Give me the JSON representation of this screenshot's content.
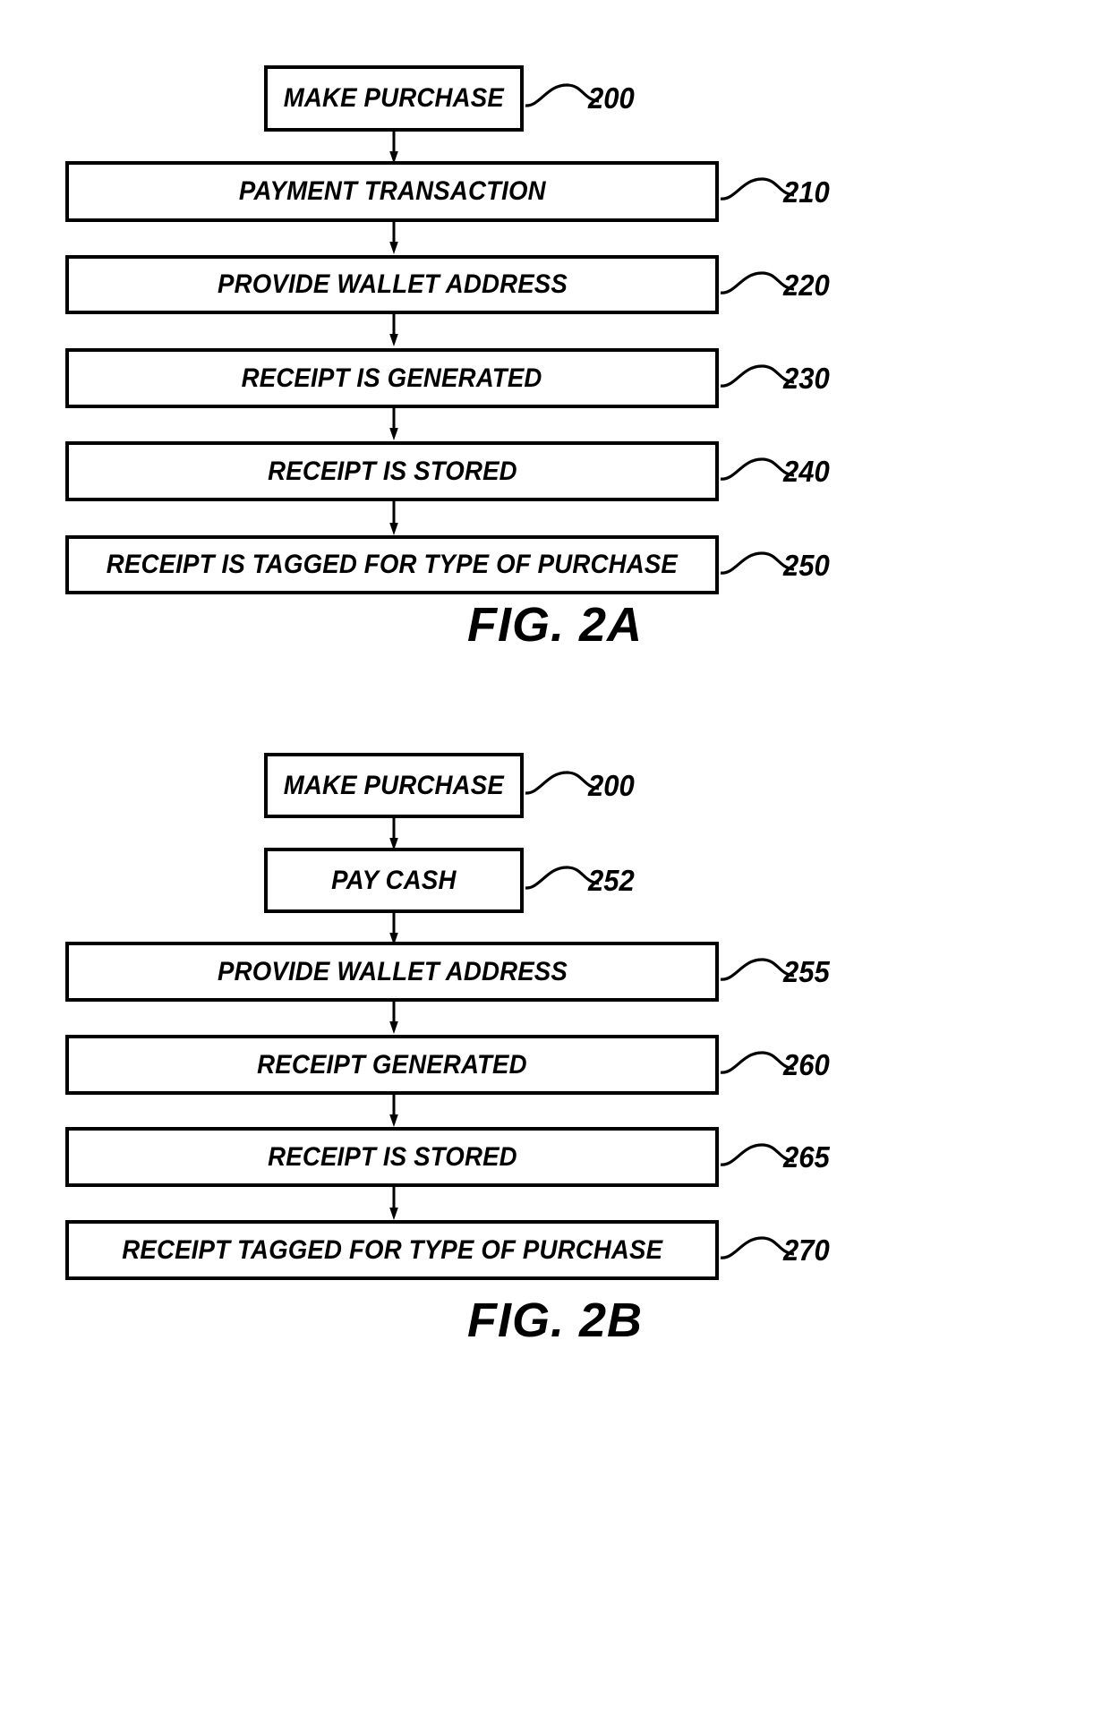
{
  "document": {
    "type": "patent-flowchart-sheet",
    "background_color": "#ffffff",
    "stroke_color": "#000000"
  },
  "figures": [
    {
      "id": "fig-2a",
      "caption": "FIG. 2A",
      "nodes": [
        {
          "id": "200",
          "label": "MAKE PURCHASE",
          "ref": "200",
          "width": "narrow"
        },
        {
          "id": "210",
          "label": "PAYMENT TRANSACTION",
          "ref": "210",
          "width": "wide"
        },
        {
          "id": "220",
          "label": "PROVIDE WALLET ADDRESS",
          "ref": "220",
          "width": "wide"
        },
        {
          "id": "230",
          "label": "RECEIPT IS GENERATED",
          "ref": "230",
          "width": "wide"
        },
        {
          "id": "240",
          "label": "RECEIPT IS STORED",
          "ref": "240",
          "width": "wide"
        },
        {
          "id": "250",
          "label": "RECEIPT IS TAGGED FOR TYPE OF PURCHASE",
          "ref": "250",
          "width": "wide"
        }
      ]
    },
    {
      "id": "fig-2b",
      "caption": "FIG. 2B",
      "nodes": [
        {
          "id": "200b",
          "label": "MAKE PURCHASE",
          "ref": "200",
          "width": "narrow"
        },
        {
          "id": "252",
          "label": "PAY CASH",
          "ref": "252",
          "width": "narrow"
        },
        {
          "id": "255",
          "label": "PROVIDE WALLET ADDRESS",
          "ref": "255",
          "width": "wide"
        },
        {
          "id": "260",
          "label": "RECEIPT GENERATED",
          "ref": "260",
          "width": "wide"
        },
        {
          "id": "265",
          "label": "RECEIPT IS STORED",
          "ref": "265",
          "width": "wide"
        },
        {
          "id": "270",
          "label": "RECEIPT TAGGED FOR TYPE OF PURCHASE",
          "ref": "270",
          "width": "wide"
        }
      ]
    }
  ]
}
